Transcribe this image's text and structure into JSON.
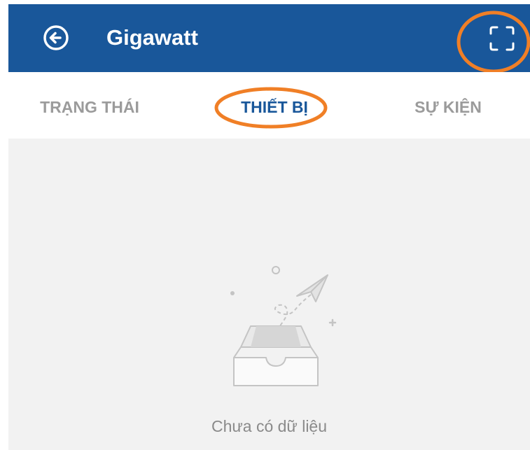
{
  "header": {
    "title": "Gigawatt",
    "back_icon": "arrow-left-circle-icon",
    "scan_icon": "scan-frame-icon",
    "background_color": "#19579a"
  },
  "tabs": [
    {
      "label": "TRẠNG THÁI",
      "active": false
    },
    {
      "label": "THIẾT BỊ",
      "active": true
    },
    {
      "label": "SỰ KIỆN",
      "active": false
    }
  ],
  "empty_state": {
    "icon": "empty-inbox-paper-plane-icon",
    "text": "Chưa có dữ liệu"
  },
  "annotations": {
    "highlight_color": "#f07f26"
  }
}
